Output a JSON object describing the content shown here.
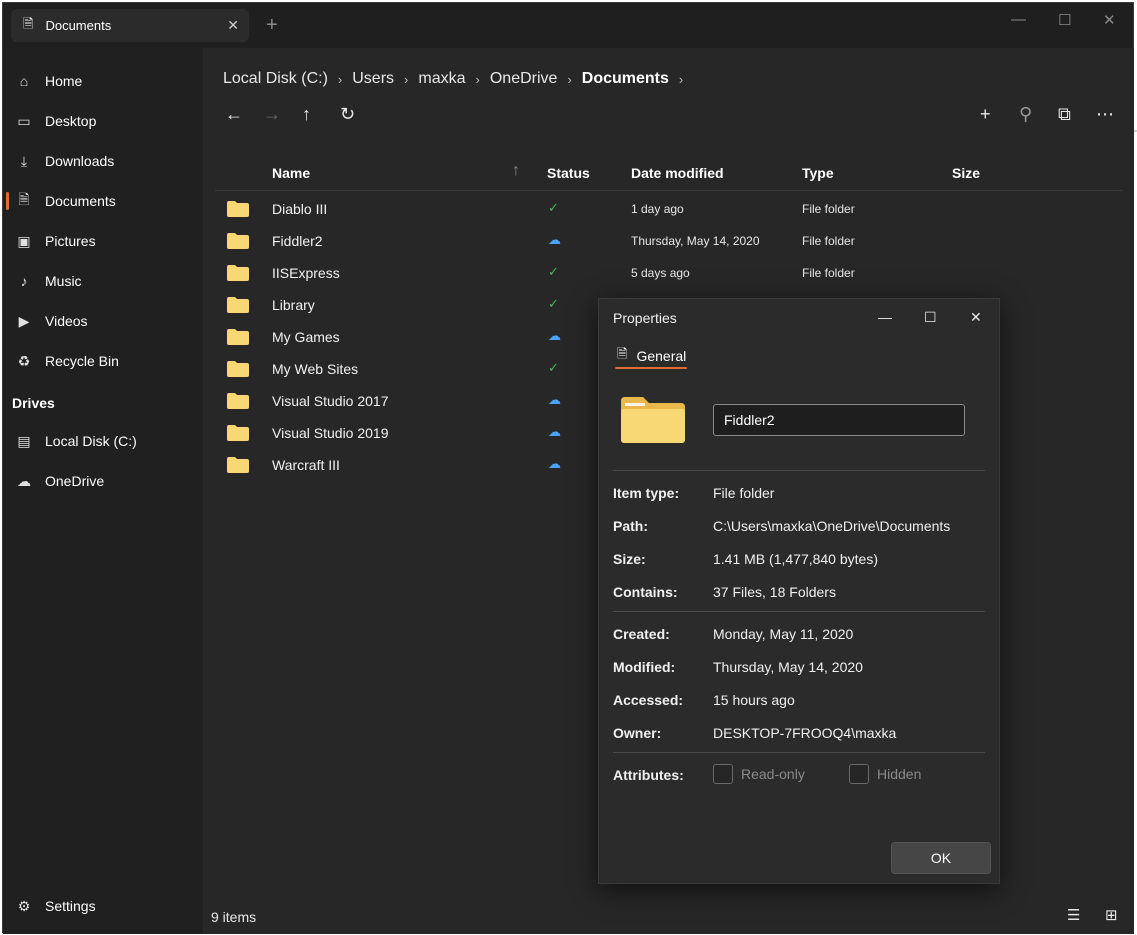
{
  "window": {
    "tab_title": "Documents",
    "tab_close": "✕",
    "new_tab": "+",
    "controls": {
      "minimize": "—",
      "maximize": "☐",
      "close": "✕"
    }
  },
  "sidebar": {
    "items": [
      {
        "label": "Home",
        "icon": "home-icon"
      },
      {
        "label": "Desktop",
        "icon": "desktop-icon"
      },
      {
        "label": "Downloads",
        "icon": "download-icon"
      },
      {
        "label": "Documents",
        "icon": "document-icon",
        "selected": true
      },
      {
        "label": "Pictures",
        "icon": "picture-icon"
      },
      {
        "label": "Music",
        "icon": "music-icon"
      },
      {
        "label": "Videos",
        "icon": "video-icon"
      },
      {
        "label": "Recycle Bin",
        "icon": "recycle-bin-icon"
      }
    ],
    "drives_header": "Drives",
    "drives": [
      {
        "label": "Local Disk (C:)",
        "icon": "drive-icon"
      },
      {
        "label": "OneDrive",
        "icon": "cloud-icon"
      }
    ],
    "settings": "Settings"
  },
  "breadcrumb": [
    "Local Disk (C:)",
    "Users",
    "maxka",
    "OneDrive",
    "Documents"
  ],
  "columns": {
    "name": "Name",
    "status": "Status",
    "date": "Date modified",
    "type": "Type",
    "size": "Size"
  },
  "files": [
    {
      "name": "Diablo III",
      "status": "synced",
      "date": "1 day ago",
      "type": "File folder"
    },
    {
      "name": "Fiddler2",
      "status": "cloud",
      "date": "Thursday, May 14, 2020",
      "type": "File folder"
    },
    {
      "name": "IISExpress",
      "status": "synced",
      "date": "5 days ago",
      "type": "File folder"
    },
    {
      "name": "Library",
      "status": "synced",
      "date": "",
      "type": ""
    },
    {
      "name": "My Games",
      "status": "cloud",
      "date": "",
      "type": ""
    },
    {
      "name": "My Web Sites",
      "status": "synced",
      "date": "",
      "type": ""
    },
    {
      "name": "Visual Studio 2017",
      "status": "cloud",
      "date": "",
      "type": ""
    },
    {
      "name": "Visual Studio 2019",
      "status": "cloud",
      "date": "",
      "type": ""
    },
    {
      "name": "Warcraft III",
      "status": "cloud",
      "date": "",
      "type": ""
    }
  ],
  "status_bar": {
    "item_count": "9 items"
  },
  "dialog": {
    "title": "Properties",
    "tab": "General",
    "name_value": "Fiddler2",
    "item_type_label": "Item type:",
    "item_type": "File folder",
    "path_label": "Path:",
    "path": "C:\\Users\\maxka\\OneDrive\\Documents",
    "size_label": "Size:",
    "size": "1.41 MB (1,477,840 bytes)",
    "contains_label": "Contains:",
    "contains": "37 Files, 18 Folders",
    "created_label": "Created:",
    "created": "Monday, May 11, 2020",
    "modified_label": "Modified:",
    "modified": "Thursday, May 14, 2020",
    "accessed_label": "Accessed:",
    "accessed": "15 hours ago",
    "owner_label": "Owner:",
    "owner": "DESKTOP-7FROOQ4\\maxka",
    "attributes_label": "Attributes:",
    "readonly_label": "Read-only",
    "hidden_label": "Hidden",
    "ok_label": "OK"
  },
  "colors": {
    "accent": "#e66b2f",
    "synced": "#3fb950",
    "cloud": "#4aa3ff",
    "folder": "#f8d775"
  }
}
